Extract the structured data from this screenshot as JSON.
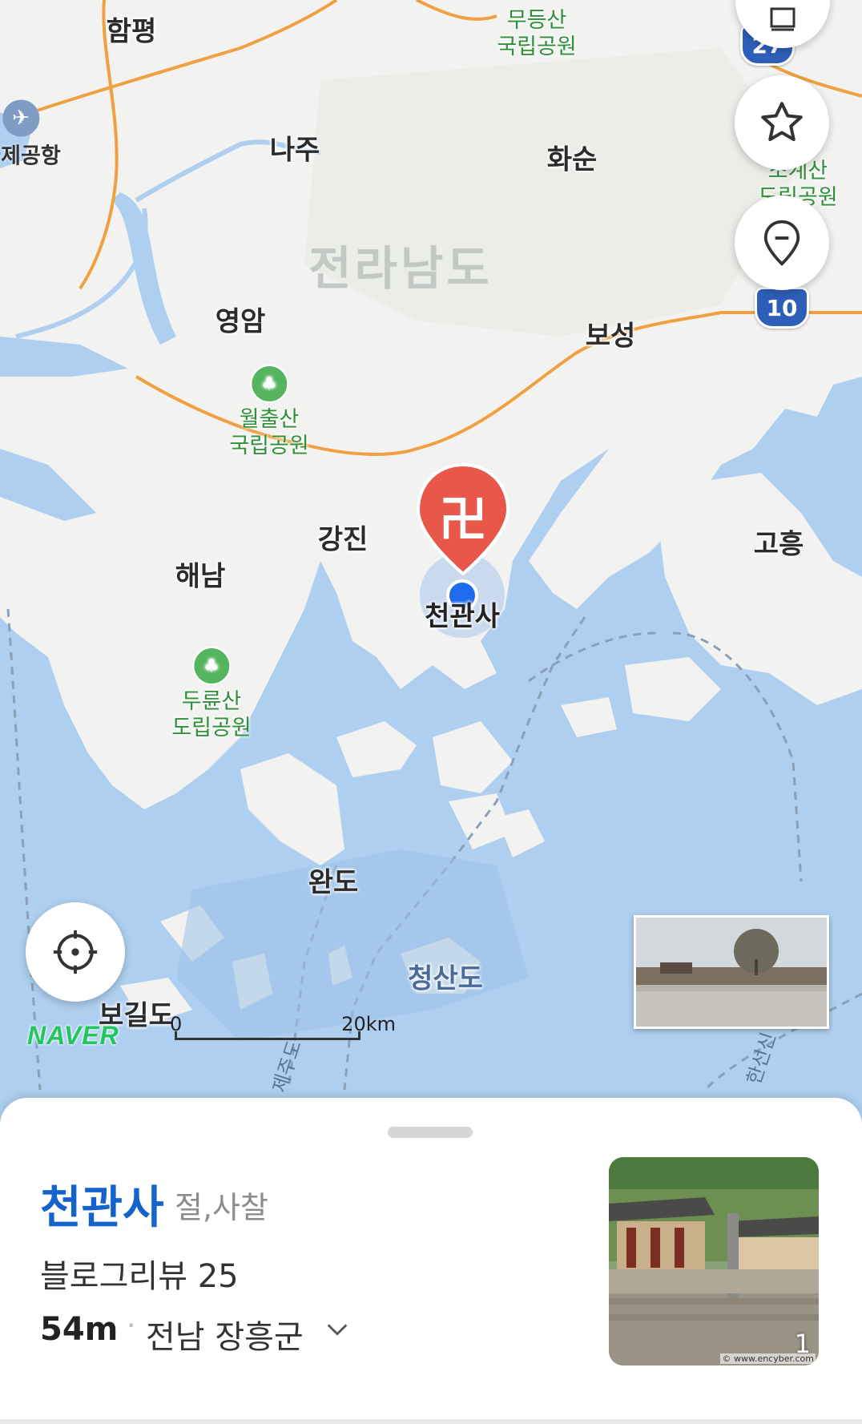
{
  "map": {
    "region_label": "전라남도",
    "places": [
      {
        "id": "hampyeong",
        "label": "함평"
      },
      {
        "id": "naju",
        "label": "나주"
      },
      {
        "id": "hwasun",
        "label": "화순"
      },
      {
        "id": "yeongam",
        "label": "영암"
      },
      {
        "id": "boseong",
        "label": "보성"
      },
      {
        "id": "gangjin",
        "label": "강진"
      },
      {
        "id": "haenam",
        "label": "해남"
      },
      {
        "id": "goheung",
        "label": "고흥"
      },
      {
        "id": "wando",
        "label": "완도"
      },
      {
        "id": "cheongsando",
        "label": "청산도"
      },
      {
        "id": "bogildo",
        "label": "보길도"
      }
    ],
    "parks": [
      {
        "id": "mudeungsan",
        "line1": "무등산",
        "line2": "국립공원"
      },
      {
        "id": "wolchulsan",
        "line1": "월출산",
        "line2": "국립공원"
      },
      {
        "id": "duryunsan",
        "line1": "두륜산",
        "line2": "도립공원"
      },
      {
        "id": "jogyesan",
        "line1": "조계산",
        "line2": "도립공원"
      }
    ],
    "airport_label": "국제공항",
    "route_badges": [
      "10",
      "27"
    ],
    "ferry_labels": [
      "제주도",
      "한선신"
    ],
    "pin": {
      "symbol": "卍",
      "label": "천관사",
      "color": "#e8574a"
    },
    "scale": {
      "start": "0",
      "end": "20km"
    },
    "logo": "NAVER",
    "colors": {
      "land": "#f2f3f1",
      "sea": "#aecff0",
      "road": "#f0a040",
      "accent": "#1263cc"
    }
  },
  "controls": {
    "layers_icon": "layers-icon",
    "favorite_icon": "star-icon",
    "place_icon": "location-pin-icon",
    "locate_icon": "crosshair-icon"
  },
  "sheet": {
    "name": "천관사",
    "category": "절,사찰",
    "blog_review": "블로그리뷰 25",
    "distance": "54m",
    "separator": "·",
    "address": "전남 장흥군",
    "photo_count": "1",
    "photo_credit": "© www.encyber.com"
  }
}
